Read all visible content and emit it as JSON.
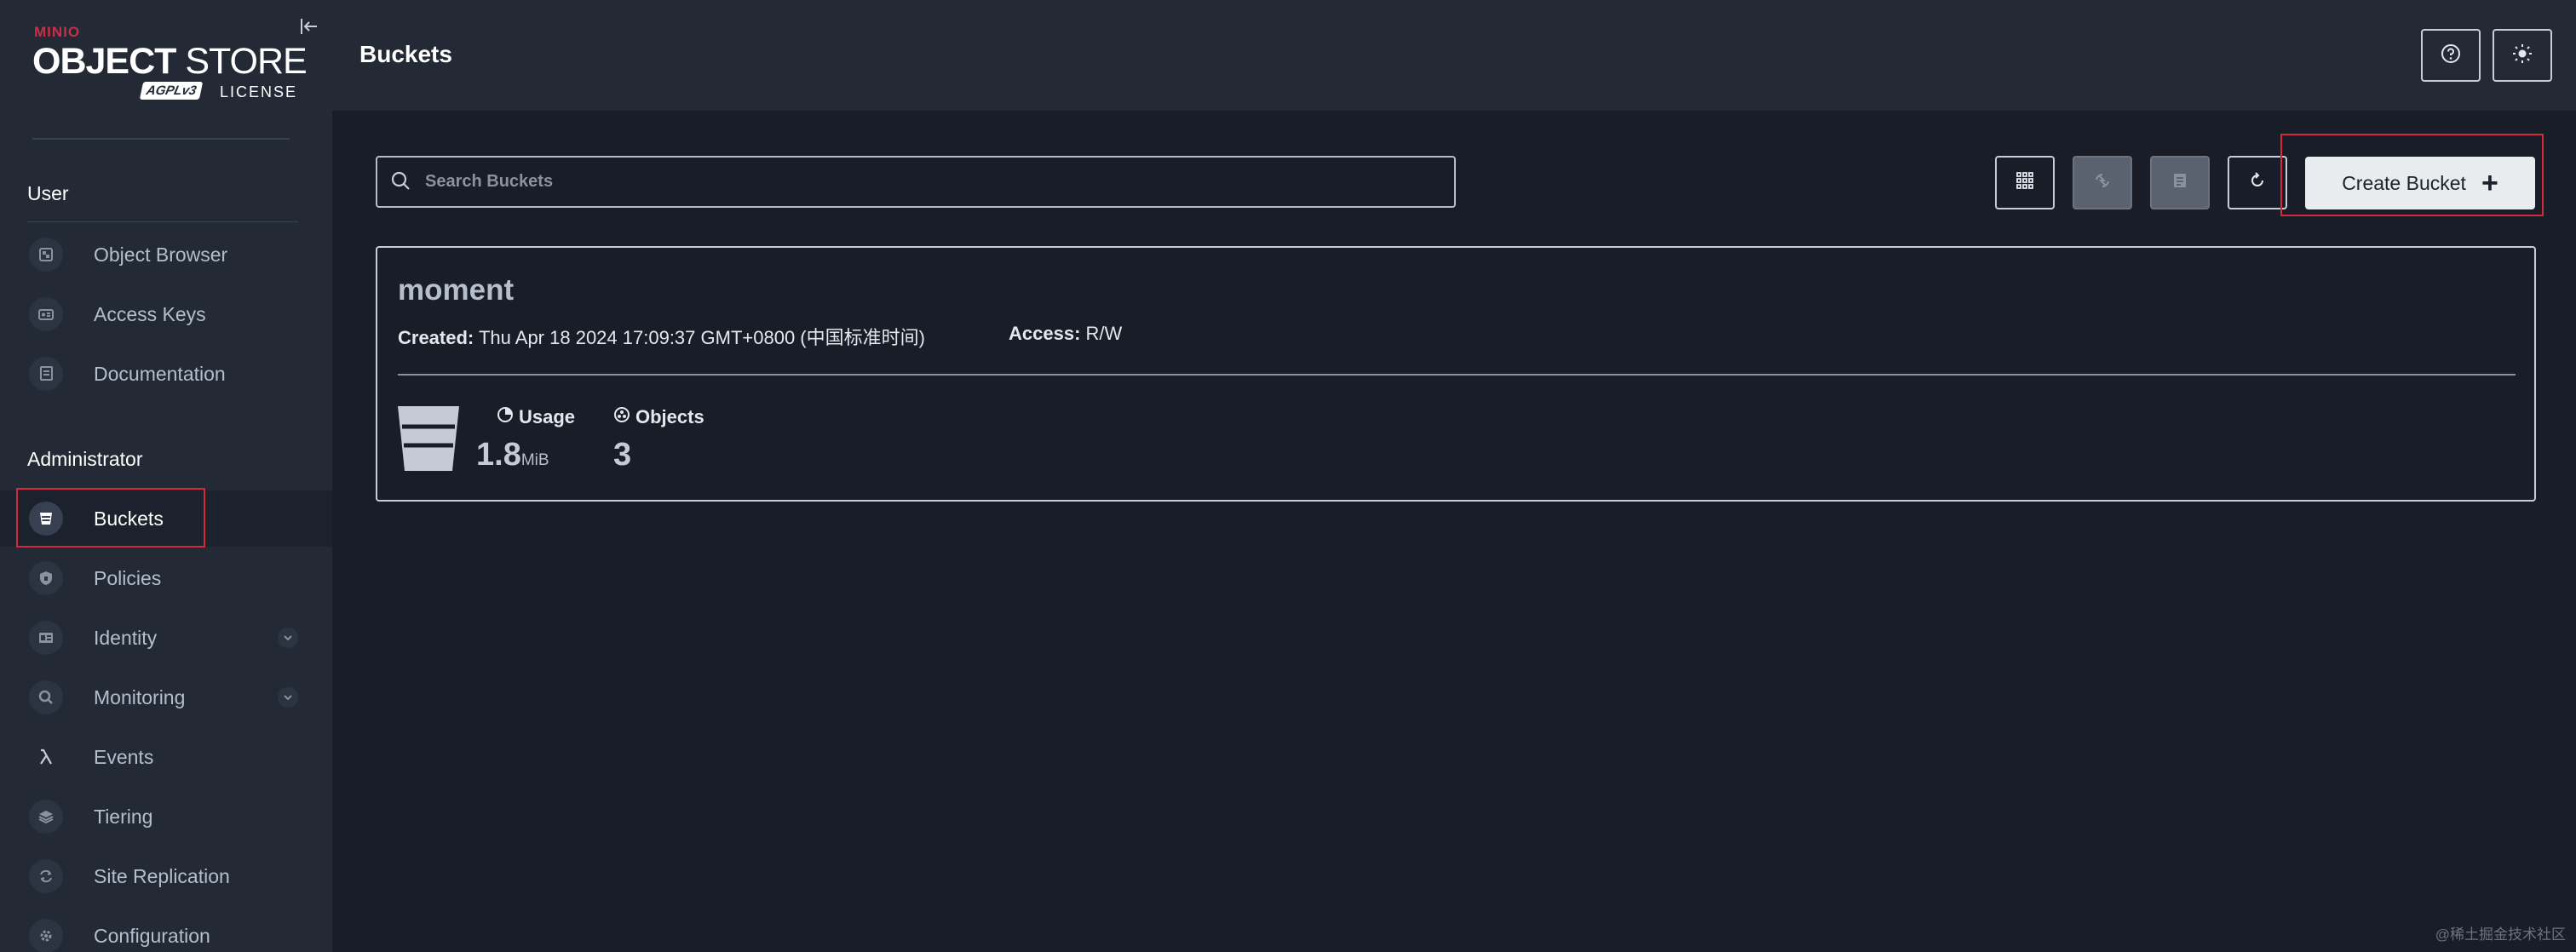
{
  "sidebar": {
    "logo": {
      "brand_small": "MINIO",
      "brand_big_bold": "OBJECT",
      "brand_big_thin": " STORE",
      "agpl": "AGPLv3",
      "license": "LICENSE"
    },
    "user_section": "User",
    "user_items": [
      {
        "label": "Object Browser",
        "icon": "object-browser-icon"
      },
      {
        "label": "Access Keys",
        "icon": "access-keys-icon"
      },
      {
        "label": "Documentation",
        "icon": "documentation-icon"
      }
    ],
    "admin_section": "Administrator",
    "admin_items": [
      {
        "label": "Buckets",
        "icon": "bucket-icon",
        "active": true
      },
      {
        "label": "Policies",
        "icon": "shield-icon"
      },
      {
        "label": "Identity",
        "icon": "id-card-icon",
        "expandable": true
      },
      {
        "label": "Monitoring",
        "icon": "magnifier-icon",
        "expandable": true
      },
      {
        "label": "Events",
        "icon": "lambda-icon"
      },
      {
        "label": "Tiering",
        "icon": "layers-icon"
      },
      {
        "label": "Site Replication",
        "icon": "replication-icon"
      },
      {
        "label": "Configuration",
        "icon": "gear-icon"
      }
    ]
  },
  "header": {
    "title": "Buckets"
  },
  "search": {
    "placeholder": "Search Buckets",
    "value": ""
  },
  "toolbar": {
    "create_label": "Create Bucket"
  },
  "bucket": {
    "name": "moment",
    "created_label": "Created:",
    "created_value": "Thu Apr 18 2024 17:09:37 GMT+0800 (中国标准时间)",
    "access_label": "Access:",
    "access_value": "R/W",
    "usage_label": "Usage",
    "usage_value": "1.8",
    "usage_unit": "MiB",
    "objects_label": "Objects",
    "objects_value": "3"
  },
  "watermark": "@稀土掘金技术社区",
  "colors": {
    "accent_red": "#d4283c",
    "brand_red": "#c72e49",
    "sidebar_bg": "#232a36",
    "main_bg": "#181d28"
  }
}
